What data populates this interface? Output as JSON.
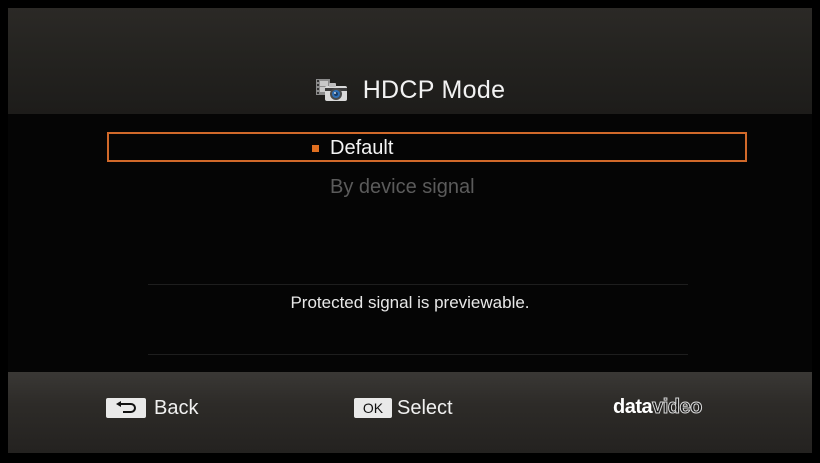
{
  "header": {
    "title": "HDCP Mode",
    "icon": "camera-film-icon"
  },
  "options": [
    {
      "label": "Default",
      "selected": true
    },
    {
      "label": "By device signal",
      "selected": false
    }
  ],
  "description": "Protected signal is previewable.",
  "footer": {
    "back_label": "Back",
    "back_icon": "return-arrow-icon",
    "ok_key_label": "OK",
    "select_label": "Select",
    "brand_part1": "data",
    "brand_part2": "video"
  },
  "colors": {
    "accent": "#d1692a",
    "bullet": "#e06f20",
    "disabled_text": "#5b5b5b"
  }
}
